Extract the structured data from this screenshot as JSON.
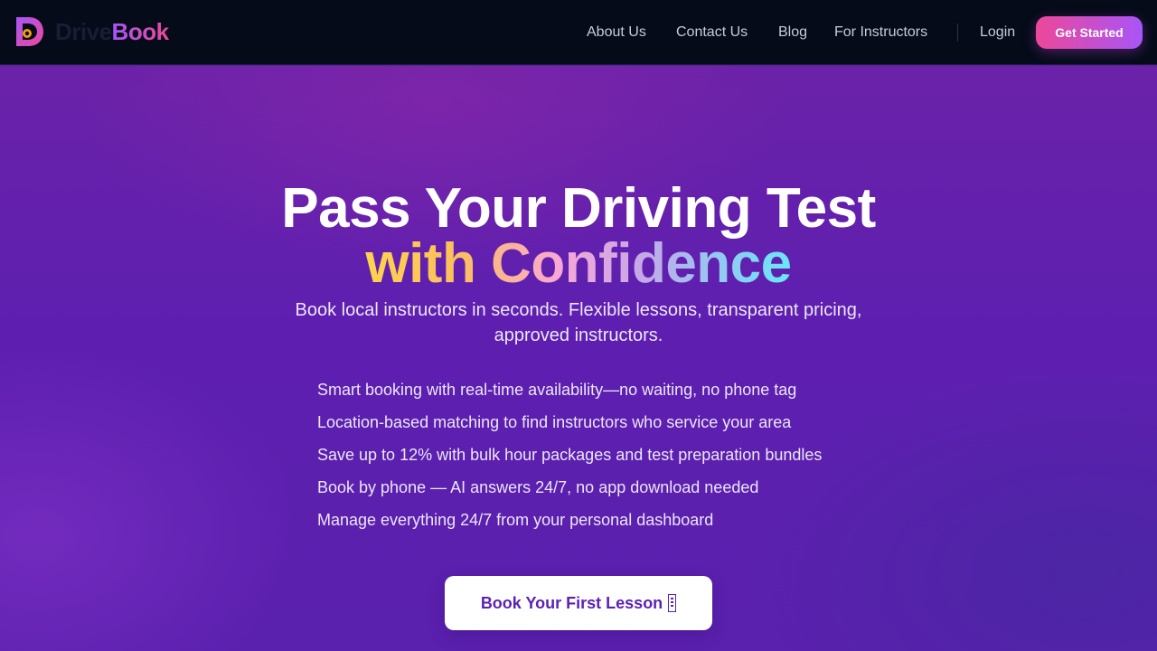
{
  "brand": {
    "name_part1": "Drive",
    "name_part2": "Book",
    "logo_icon": "letter-d-logo-icon",
    "colors": {
      "dark": "#1a1d33",
      "gradient_start": "#a855f7",
      "gradient_end": "#ec4899"
    }
  },
  "nav": {
    "links": [
      {
        "label": "About Us"
      },
      {
        "label": "Contact Us"
      },
      {
        "label": "Blog"
      },
      {
        "label": "For Instructors"
      }
    ],
    "login_label": "Login",
    "cta_label": "Get Started",
    "background": "#050b19"
  },
  "hero": {
    "headline": "Pass Your Driving Test",
    "headline_accent": "with Confidence",
    "subtitle": "Book local instructors in seconds. Flexible lessons, transparent pricing, approved instructors.",
    "features": [
      "Smart booking with real-time availability—no waiting, no phone tag",
      "Location-based matching to find instructors who service your area",
      "Save up to 12% with bulk hour packages and test preparation bundles",
      "Book by phone — AI answers 24/7, no app download needed",
      "Manage everything 24/7 from your personal dashboard"
    ],
    "cta_label": "Book Your First Lesson",
    "cta_trailing_icon": "missing-glyph-icon",
    "background": "#5e1fb0",
    "accent_gradient": [
      "#fcd34d",
      "#f9a8d4",
      "#c4a8e8",
      "#67e8f9"
    ]
  }
}
